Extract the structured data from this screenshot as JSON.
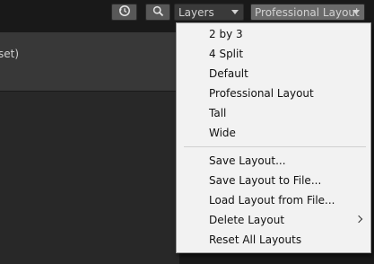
{
  "toolbar": {
    "layers_label": "Layers",
    "layout_label": "Professional Layout",
    "history_icon": "history-icon",
    "search_icon": "search-icon"
  },
  "panel": {
    "header_text": "set)"
  },
  "menu": {
    "items": [
      {
        "label": "2 by 3"
      },
      {
        "label": "4 Split"
      },
      {
        "label": "Default"
      },
      {
        "label": "Professional Layout"
      },
      {
        "label": "Tall"
      },
      {
        "label": "Wide"
      },
      {
        "label": "Save Layout..."
      },
      {
        "label": "Save Layout to File..."
      },
      {
        "label": "Load Layout from File..."
      },
      {
        "label": "Delete Layout"
      },
      {
        "label": "Reset All Layouts"
      }
    ]
  },
  "colors": {
    "toolbar_bg": "#191919",
    "button_bg": "#585858",
    "menu_bg": "#f2f2f2",
    "panel_header_bg": "#383838"
  }
}
